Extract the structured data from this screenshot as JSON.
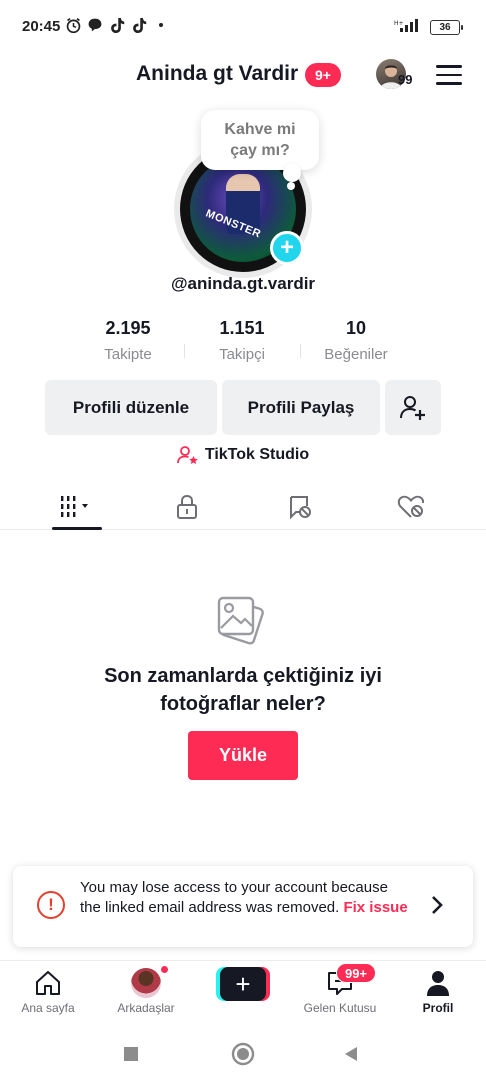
{
  "status_bar": {
    "time": "20:45",
    "battery": "36",
    "icons": [
      "alarm-icon",
      "chat-bubble-icon",
      "tiktok-icon",
      "tiktok-icon",
      "dot-icon",
      "signal-icon",
      "battery-icon"
    ]
  },
  "header": {
    "title": "Aninda gt Vardir",
    "title_badge": "9+",
    "account_badge": "99"
  },
  "profile": {
    "note": "Kahve mi çay mı?",
    "avatar_text": "MONSTER",
    "handle": "@aninda.gt.vardir",
    "stats": [
      {
        "value": "2.195",
        "label": "Takipte"
      },
      {
        "value": "1.151",
        "label": "Takipçi"
      },
      {
        "value": "10",
        "label": "Beğeniler"
      }
    ],
    "edit_button": "Profili düzenle",
    "share_button": "Profili Paylaş",
    "studio_label": "TikTok Studio"
  },
  "tabs": [
    "grid-icon",
    "lock-icon",
    "tagged-icon",
    "liked-icon"
  ],
  "empty_state": {
    "title": "Son zamanlarda çektiğiniz iyi fotoğraflar neler?",
    "button": "Yükle"
  },
  "warning": {
    "text": "You may lose access to your account because the linked email address was removed.",
    "link": "Fix issue"
  },
  "bottom_nav": {
    "items": [
      {
        "label": "Ana sayfa",
        "icon": "home-icon"
      },
      {
        "label": "Arkadaşlar",
        "icon": "friends-avatar"
      },
      {
        "label": "",
        "icon": "create-icon"
      },
      {
        "label": "Gelen Kutusu",
        "icon": "inbox-icon"
      },
      {
        "label": "Profil",
        "icon": "profile-icon"
      }
    ],
    "inbox_badge": "99+",
    "active": "Profil"
  },
  "colors": {
    "accent": "#fe2c55",
    "cyan": "#25f4ee",
    "text": "#161823",
    "muted": "#8a8b91"
  }
}
